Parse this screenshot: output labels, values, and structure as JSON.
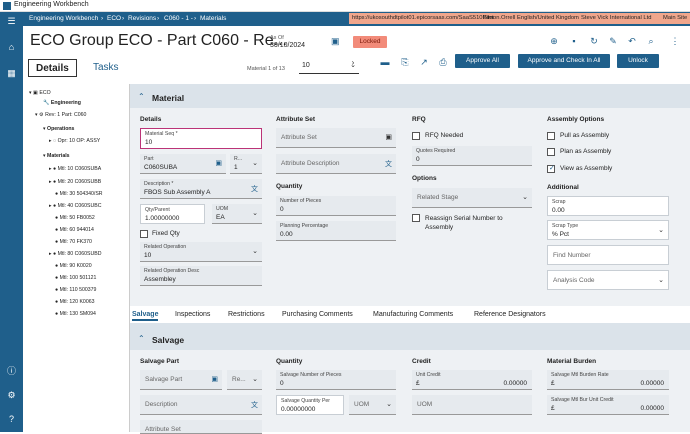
{
  "window_title": "Engineering Workbench",
  "breadcrumb": [
    "Engineering Workbench",
    "ECO",
    "Revisions",
    "C060 - 1 -",
    "Materials"
  ],
  "user_bar": {
    "url": "https://ukosouthdtpilot01.epicorsaas.com/SaaS510Pilot",
    "user": "Simon.Orrell",
    "lang": "English/United Kingdom",
    "company": "Steve Vick International Ltd",
    "site": "Main Site"
  },
  "header": {
    "title": "ECO Group ECO - Part C060 - Re...",
    "as_of_label": "As Of",
    "as_of_value": "30/10/2024",
    "status": "Locked"
  },
  "tabs": {
    "details": "Details",
    "tasks": "Tasks"
  },
  "pager": {
    "text": "Material 1 of 13",
    "value": "10"
  },
  "buttons": {
    "approve_all": "Approve All",
    "approve_checkin": "Approve and Check In All",
    "unlock": "Unlock"
  },
  "tree": {
    "eco": "ECO",
    "engineering": "Engineering",
    "rev": "Rev: 1 Part: C060",
    "operations": "Operations",
    "opr": "Opr: 10 OP: ASSY",
    "materials": "Materials",
    "mtl": [
      "Mtl: 10 C060SUBA",
      "Mtl: 20 C060SUBB",
      "Mtl: 30 504340/SR",
      "Mtl: 40 C060SUBC",
      "Mtl: 50 FB0052",
      "Mtl: 60 944014",
      "Mtl: 70 FK370",
      "Mtl: 80 C060SUBD",
      "Mtl: 90 K0020",
      "Mtl: 100 501121",
      "Mtl: 110 500379",
      "Mtl: 120 K0063",
      "Mtl: 130 SM094"
    ]
  },
  "material": {
    "section": "Material",
    "details": "Details",
    "seq_label": "Material Seq *",
    "seq_value": "10",
    "part_label": "Part",
    "part_value": "C060SUBA",
    "rev_label": "R...",
    "rev_value": "1",
    "desc_label": "Description *",
    "desc_value": "FBOS Sub Assembly A",
    "qty_label": "Qty/Parent",
    "qty_value": "1.00000000",
    "uom_label": "UOM",
    "uom_value": "EA",
    "fixed_qty": "Fixed Qty",
    "relop_label": "Related Operation",
    "relop_value": "10",
    "relopdesc_label": "Related Operation Desc",
    "relopdesc_value": "Assembley",
    "attr_head": "Attribute Set",
    "attr_set": "Attribute Set",
    "attr_desc": "Attribute Description",
    "qty_head": "Quantity",
    "pieces_label": "Number of Pieces",
    "pieces_value": "0",
    "plan_pct_label": "Planning Percentage",
    "plan_pct_value": "0.00",
    "rfq_head": "RFQ",
    "rfq_needed": "RFQ Needed",
    "quotes_label": "Quotes Required",
    "quotes_value": "0",
    "opt_head": "Options",
    "related_stage": "Related Stage",
    "reassign": "Reassign Serial Number to Assembly",
    "asm_head": "Assembly Options",
    "pull": "Pull as Assembly",
    "plan": "Plan as Assembly",
    "view": "View as Assembly",
    "add_head": "Additional",
    "scrap_label": "Scrap",
    "scrap_value": "0.00",
    "scraptype_label": "Scrap Type",
    "scraptype_value": "% Pct",
    "find_number": "Find Number",
    "analysis_code": "Analysis Code"
  },
  "subtabs": [
    "Salvage",
    "Inspections",
    "Restrictions",
    "Purchasing Comments",
    "Manufacturing Comments",
    "Reference Designators"
  ],
  "salvage": {
    "section": "Salvage",
    "part_head": "Salvage Part",
    "part_ph": "Salvage Part",
    "rev_ph": "Re...",
    "desc_ph": "Description",
    "attr_ph": "Attribute Set",
    "qty_head": "Quantity",
    "num_label": "Salvage Number of Pieces",
    "num_value": "0",
    "qtyper_label": "Salvage Quantity Per",
    "qtyper_value": "0.00000000",
    "uom_ph": "UOM",
    "credit_head": "Credit",
    "unitcredit_label": "Unit Credit",
    "unitcredit_cur": "£",
    "unitcredit_value": "0.00000",
    "uom2_ph": "UOM",
    "burden_head": "Material Burden",
    "rate_label": "Salvage Mtl Burden Rate",
    "rate_cur": "£",
    "rate_value": "0.00000",
    "unitcr_label": "Salvage Mtl Bur Unit Credit",
    "unitcr_cur": "£",
    "unitcr_value": "0.00000"
  }
}
